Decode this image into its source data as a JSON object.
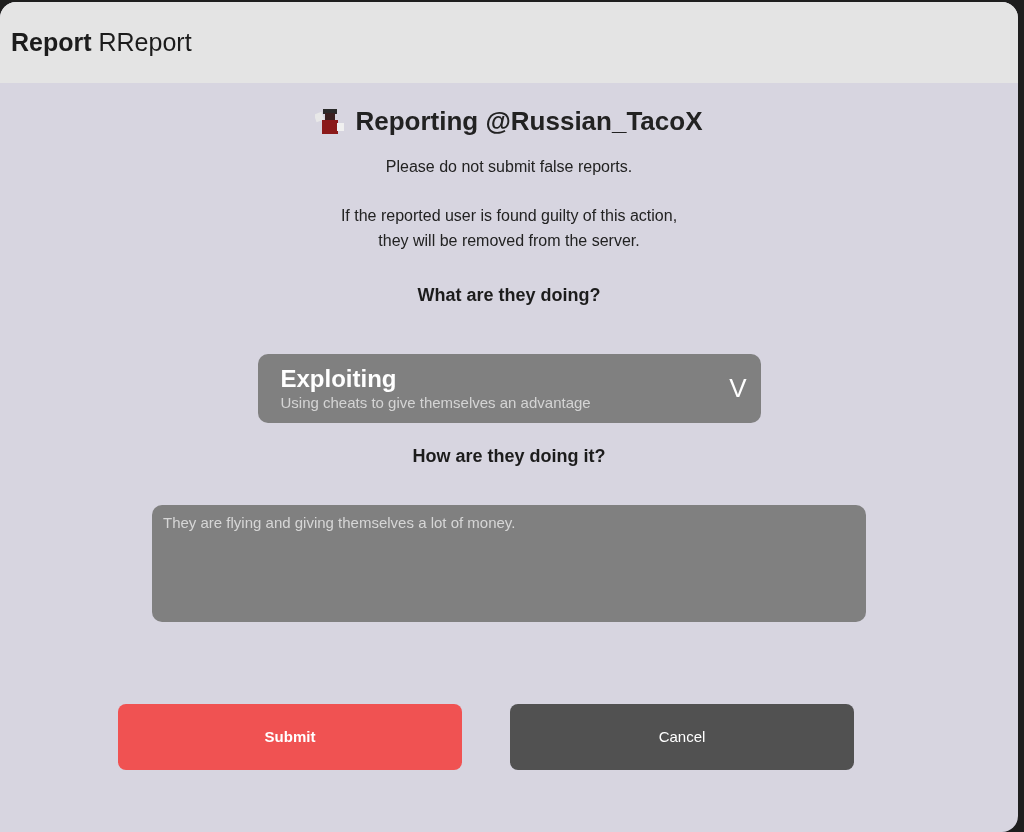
{
  "window": {
    "title": "**Report** RReport"
  },
  "report": {
    "heading": "Reporting @Russian_TacoX",
    "notice": "Please do not submit false reports.",
    "warning": "If the reported user is found guilty of this action, they will be removed from the server.",
    "question_1": "What are they doing?",
    "category": {
      "title": "Exploiting",
      "description": "Using cheats to give themselves an advantage",
      "chevron": "V"
    },
    "question_2": "How are they doing it?",
    "details": {
      "value": "They are flying and giving themselves a lot of money."
    }
  },
  "buttons": [
    {
      "label": "Submit",
      "kind": "primary"
    },
    {
      "label": "Cancel",
      "kind": "secondary"
    }
  ]
}
